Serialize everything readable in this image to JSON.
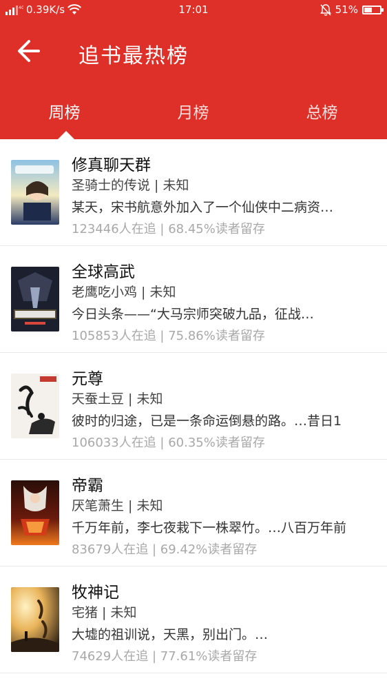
{
  "status_bar": {
    "network": "0.39K/s",
    "time": "17:01",
    "battery": "51%",
    "battery_level": 0.51
  },
  "header": {
    "title": "追书最热榜",
    "back_icon": "arrow-left-icon"
  },
  "tabs": [
    {
      "label": "周榜",
      "active": true
    },
    {
      "label": "月榜",
      "active": false
    },
    {
      "label": "总榜",
      "active": false
    }
  ],
  "books": [
    {
      "title": "修真聊天群",
      "author": "圣骑士的传说 | 未知",
      "desc": "某天，宋书航意外加入了一个仙侠中二病资…",
      "stats": "123446人在追 |  68.45%读者留存",
      "cover_colors": [
        "#7fb3d8",
        "#f3e9c0",
        "#2b3c66"
      ]
    },
    {
      "title": "全球高武",
      "author": "老鹰吃小鸡 | 未知",
      "desc": "今日头条——“大马宗师突破九品，征战…",
      "stats": "105853人在追 |  75.86%读者留存",
      "cover_colors": [
        "#1b1f2e",
        "#c9a43a",
        "#d8483a"
      ]
    },
    {
      "title": "元尊",
      "author": "天蚕土豆 | 未知",
      "desc": "彼时的归途，已是一条命运倒悬的路。…昔日1",
      "stats": "106033人在追 |  60.35%读者留存",
      "cover_colors": [
        "#f4f1ec",
        "#1a1a1a",
        "#c43a31"
      ]
    },
    {
      "title": "帝霸",
      "author": "厌笔萧生 | 未知",
      "desc": "千万年前，李七夜栽下一株翠竹。…八百万年前",
      "stats": "83679人在追 |  69.42%读者留存",
      "cover_colors": [
        "#2a0e08",
        "#f07a1e",
        "#d83a18"
      ]
    },
    {
      "title": "牧神记",
      "author": "宅猪 | 未知",
      "desc": "大墟的祖训说，天黑，别出门。…",
      "stats": "74629人在追 |  77.61%读者留存",
      "cover_colors": [
        "#e9b45a",
        "#6a4a2a",
        "#2b1d12"
      ]
    }
  ]
}
